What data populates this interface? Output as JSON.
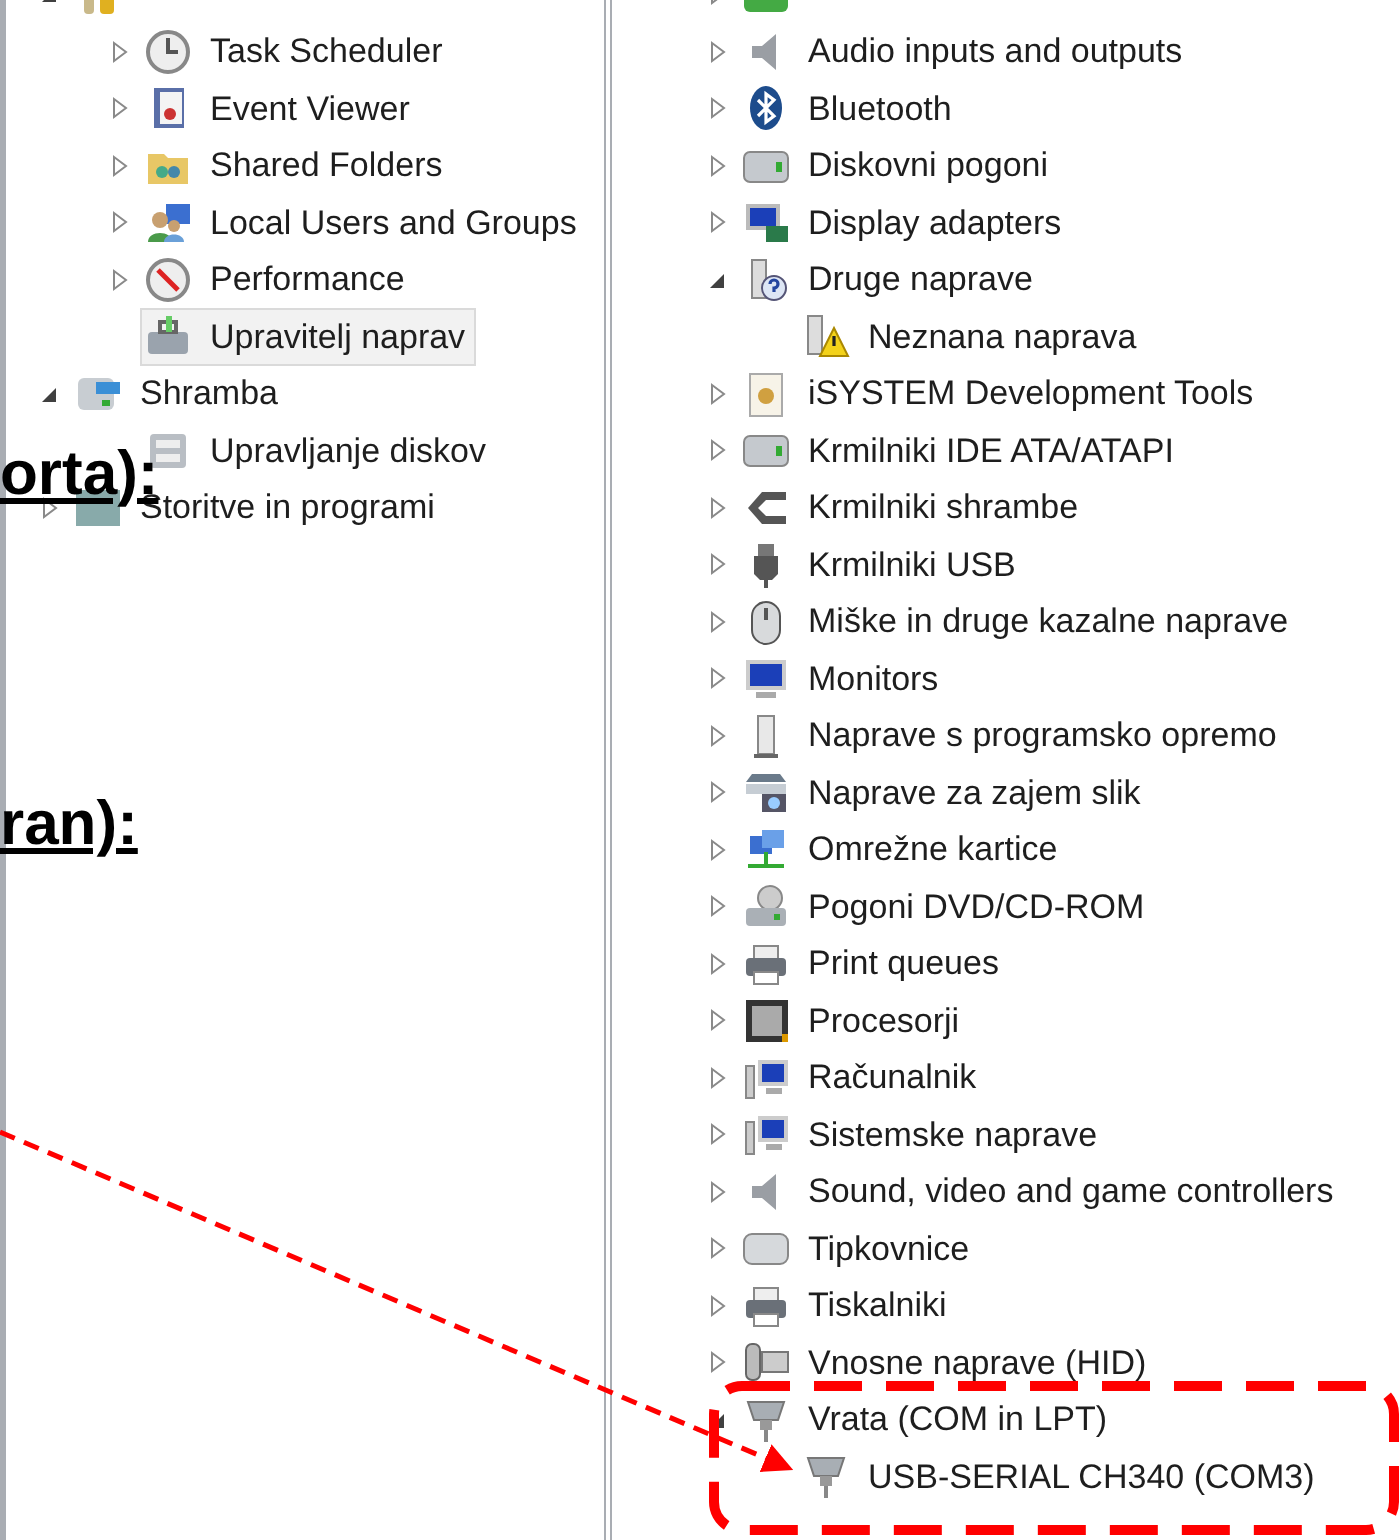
{
  "left_tree": [
    {
      "kind": "tools",
      "expanded": true,
      "selected": false,
      "children": [
        {
          "label": "Task Scheduler",
          "kind": "clock",
          "expanded": false,
          "selected": false
        },
        {
          "label": "Event Viewer",
          "kind": "log",
          "expanded": false,
          "selected": false
        },
        {
          "label": "Shared Folders",
          "kind": "folder",
          "expanded": false,
          "selected": false
        },
        {
          "label": "Local Users and Groups",
          "kind": "users",
          "expanded": false,
          "selected": false
        },
        {
          "label": "Performance",
          "kind": "gauge",
          "expanded": false,
          "selected": false
        },
        {
          "label": "Upravitelj naprav",
          "kind": "toolbox",
          "selected": true
        }
      ]
    },
    {
      "label": "Shramba",
      "kind": "storage",
      "expanded": true,
      "selected": false,
      "children": [
        {
          "label": "Upravljanje diskov",
          "kind": "diskmgr",
          "selected": false
        }
      ]
    },
    {
      "label": "Storitve in programi",
      "kind": "services",
      "expanded": false,
      "selected": false
    }
  ],
  "right_tree": [
    {
      "kind": "battery",
      "expanded": false
    },
    {
      "label": "Audio inputs and outputs",
      "kind": "speaker",
      "expanded": false
    },
    {
      "label": "Bluetooth",
      "kind": "bluetooth",
      "expanded": false
    },
    {
      "label": "Diskovni pogoni",
      "kind": "drive",
      "expanded": false
    },
    {
      "label": "Display adapters",
      "kind": "display",
      "expanded": false
    },
    {
      "label": "Druge naprave",
      "kind": "unknown",
      "expanded": true,
      "children": [
        {
          "label": "Neznana naprava",
          "kind": "warning"
        }
      ]
    },
    {
      "label": "iSYSTEM Development Tools",
      "kind": "gear",
      "expanded": false
    },
    {
      "label": "Krmilniki IDE ATA/ATAPI",
      "kind": "drive",
      "expanded": false
    },
    {
      "label": "Krmilniki shrambe",
      "kind": "controller",
      "expanded": false
    },
    {
      "label": "Krmilniki USB",
      "kind": "usb",
      "expanded": false
    },
    {
      "label": "Miške in druge kazalne naprave",
      "kind": "mouse",
      "expanded": false
    },
    {
      "label": "Monitors",
      "kind": "monitor",
      "expanded": false
    },
    {
      "label": "Naprave s programsko opremo",
      "kind": "tower",
      "expanded": false
    },
    {
      "label": "Naprave za zajem slik",
      "kind": "scanner",
      "expanded": false
    },
    {
      "label": "Omrežne kartice",
      "kind": "network",
      "expanded": false
    },
    {
      "label": "Pogoni DVD/CD-ROM",
      "kind": "dvd",
      "expanded": false
    },
    {
      "label": "Print queues",
      "kind": "printer",
      "expanded": false
    },
    {
      "label": "Procesorji",
      "kind": "cpu",
      "expanded": false
    },
    {
      "label": "Računalnik",
      "kind": "computer",
      "expanded": false
    },
    {
      "label": "Sistemske naprave",
      "kind": "computer",
      "expanded": false
    },
    {
      "label": "Sound, video and game controllers",
      "kind": "speaker",
      "expanded": false
    },
    {
      "label": "Tipkovnice",
      "kind": "keyboard",
      "expanded": false
    },
    {
      "label": "Tiskalniki",
      "kind": "printer",
      "expanded": false
    },
    {
      "label": "Vnosne naprave (HID)",
      "kind": "hid",
      "expanded": false
    },
    {
      "label": "Vrata (COM in LPT)",
      "kind": "port",
      "expanded": true,
      "children": [
        {
          "label": "USB-SERIAL CH340 (COM3)",
          "kind": "port"
        }
      ]
    }
  ],
  "annotations": {
    "captions": [
      "orta):",
      "ran):"
    ],
    "arrow": true,
    "frame": true
  }
}
